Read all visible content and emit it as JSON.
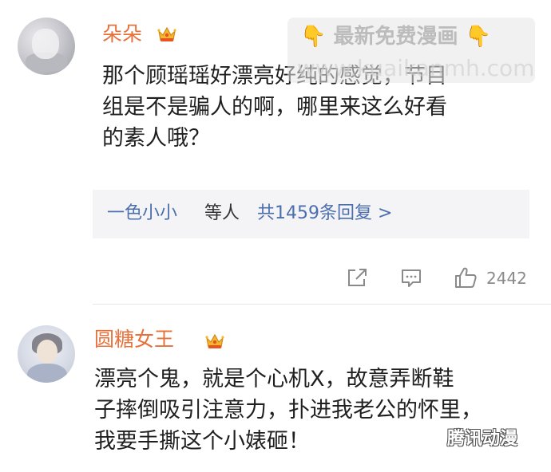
{
  "comments": [
    {
      "username": "朵朵",
      "badge_icon": "crown-badge-icon",
      "text_lines": [
        "那个顾瑶瑶好漂亮好纯的感觉，节目",
        "组是不是骗人的啊，哪里来这么好看",
        "的素人哦？"
      ],
      "reply_preview": {
        "replier": "一色小小",
        "etc": "等人",
        "total": "共1459条回复 >"
      },
      "actions": {
        "share_icon": "share-icon",
        "comment_icon": "comment-icon",
        "like_icon": "thumbs-up-icon",
        "like_count": "2442"
      }
    },
    {
      "username": "圆糖女王",
      "badge_icon": "crown-badge-icon",
      "text_lines": [
        "漂亮个鬼，就是个心机X，故意弄断鞋",
        "子摔倒吸引注意力，扑进我老公的怀里，",
        "我要手撕这个小婊砸！"
      ]
    }
  ],
  "watermark": {
    "hand_icon": "pointing-down-hand-icon",
    "text": "最新免费漫画",
    "url": "www.kuaikanmh.com"
  },
  "corner_logo": "腾讯动漫",
  "colors": {
    "username": "#e8703a",
    "link": "#4b6fae",
    "reply_bg": "#f4f4f6",
    "icon_gray": "#8a8a8a"
  }
}
